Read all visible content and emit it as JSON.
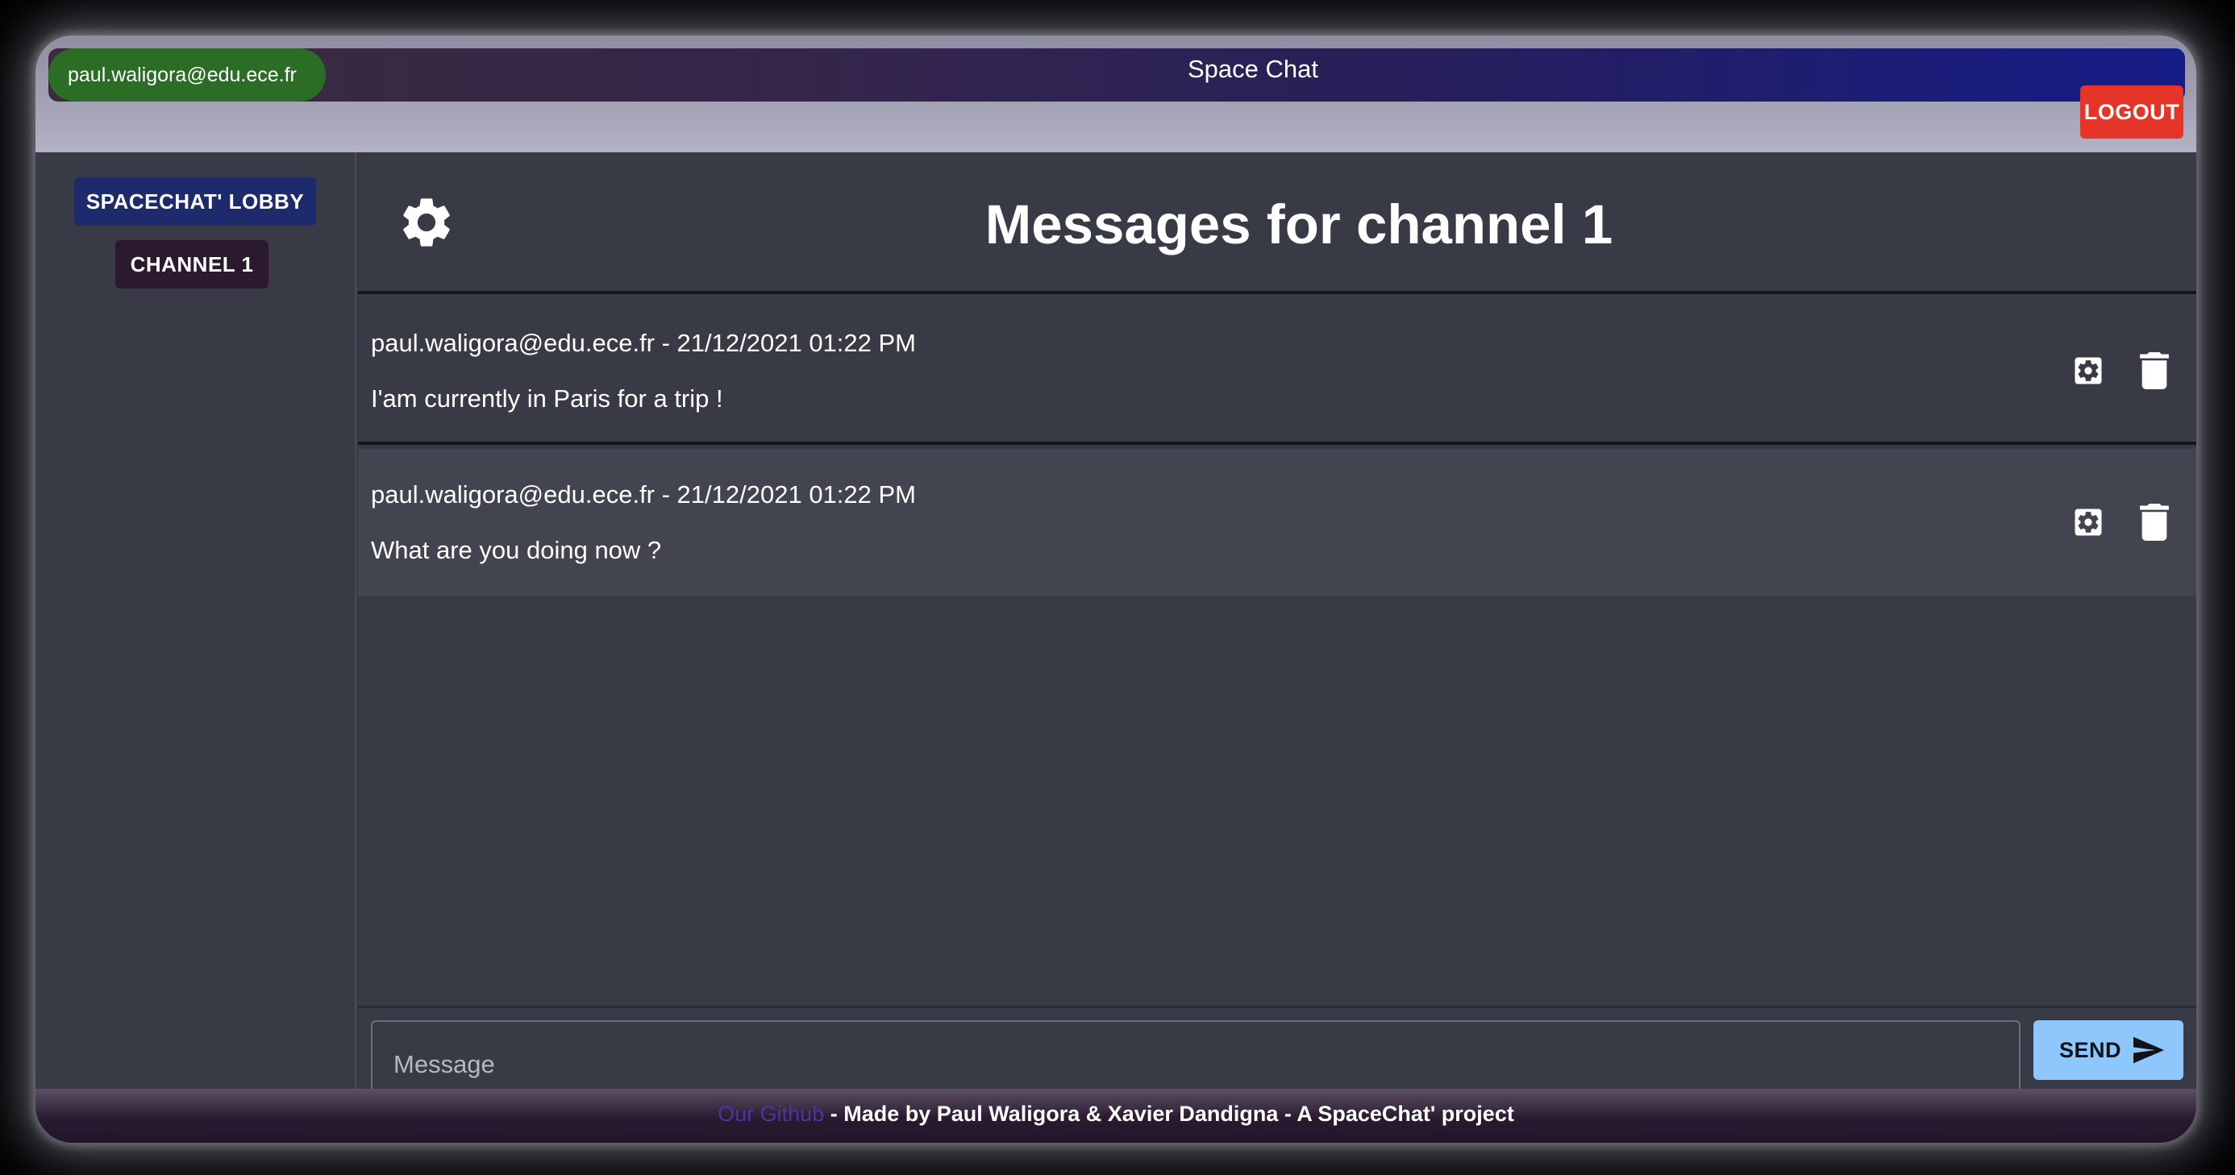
{
  "header": {
    "user_email": "paul.waligora@edu.ece.fr",
    "app_title": "Space Chat",
    "logout_label": "LOGOUT"
  },
  "sidebar": {
    "channels": [
      {
        "label": "SPACECHAT' LOBBY"
      },
      {
        "label": "CHANNEL 1"
      }
    ]
  },
  "main": {
    "settings_icon": "gear-icon",
    "title": "Messages for channel 1",
    "messages": [
      {
        "meta": "paul.waligora@edu.ece.fr - 21/12/2021 01:22 PM",
        "text": "I'am currently in Paris for a trip !",
        "edit_icon": "gear-icon",
        "delete_icon": "trash-icon"
      },
      {
        "meta": "paul.waligora@edu.ece.fr - 21/12/2021 01:22 PM",
        "text": "What are you doing now ?",
        "edit_icon": "gear-icon",
        "delete_icon": "trash-icon"
      }
    ]
  },
  "composer": {
    "placeholder": "Message",
    "value": "",
    "send_label": "SEND",
    "send_icon": "send-icon"
  },
  "footer": {
    "link_text": "Our Github",
    "text": " - Made by Paul Waligora & Xavier Dandigna - A SpaceChat' project"
  },
  "colors": {
    "user_pill": "#2b6d25",
    "logout": "#e53428",
    "lobby_button": "#1d2a6b",
    "channel_button": "#2b1a2e",
    "send_button": "#8ec7fb",
    "background": "#383b45"
  }
}
